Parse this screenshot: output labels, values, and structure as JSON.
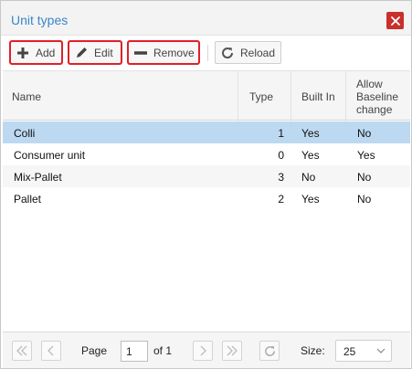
{
  "window": {
    "title": "Unit types"
  },
  "toolbar": {
    "add_label": "Add",
    "edit_label": "Edit",
    "remove_label": "Remove",
    "reload_label": "Reload"
  },
  "columns": {
    "name": "Name",
    "type": "Type",
    "built_in": "Built In",
    "allow_line1": "Allow",
    "allow_line2": "Baseline",
    "allow_line3": "change"
  },
  "rows": [
    {
      "name": "Colli",
      "type": "1",
      "built_in": "Yes",
      "allow": "No"
    },
    {
      "name": "Consumer unit",
      "type": "0",
      "built_in": "Yes",
      "allow": "Yes"
    },
    {
      "name": "Mix-Pallet",
      "type": "3",
      "built_in": "No",
      "allow": "No"
    },
    {
      "name": "Pallet",
      "type": "2",
      "built_in": "Yes",
      "allow": "No"
    }
  ],
  "pager": {
    "page_label": "Page",
    "page_value": "1",
    "of_label": "of 1",
    "size_label": "Size:",
    "size_value": "25"
  },
  "colors": {
    "title": "#3a86c8",
    "selected_row": "#bcd9f1",
    "close_button": "#c9302c",
    "highlight_outline": "#e0202a"
  },
  "icons": {
    "add": "plus-icon",
    "edit": "pencil-icon",
    "remove": "minus-icon",
    "reload": "refresh-icon",
    "close": "close-icon"
  }
}
